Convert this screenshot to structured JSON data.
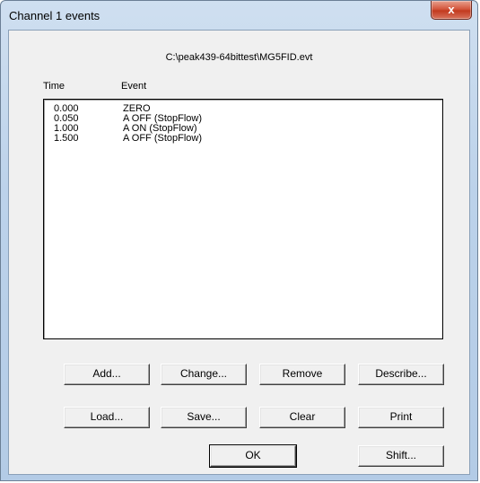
{
  "window": {
    "title": "Channel 1 events",
    "close_symbol": "x"
  },
  "file_path": "C:\\peak439-64bittest\\MG5FID.evt",
  "table": {
    "headers": {
      "time": "Time",
      "event": "Event"
    },
    "rows": [
      {
        "time": "0.000",
        "event": "ZERO"
      },
      {
        "time": "0.050",
        "event": "A OFF (StopFlow)"
      },
      {
        "time": "1.000",
        "event": "A ON (StopFlow)"
      },
      {
        "time": "1.500",
        "event": "A OFF (StopFlow)"
      }
    ]
  },
  "buttons": {
    "add": "Add...",
    "change": "Change...",
    "remove": "Remove",
    "describe": "Describe...",
    "load": "Load...",
    "save": "Save...",
    "clear": "Clear",
    "print": "Print",
    "ok": "OK",
    "shift": "Shift..."
  }
}
